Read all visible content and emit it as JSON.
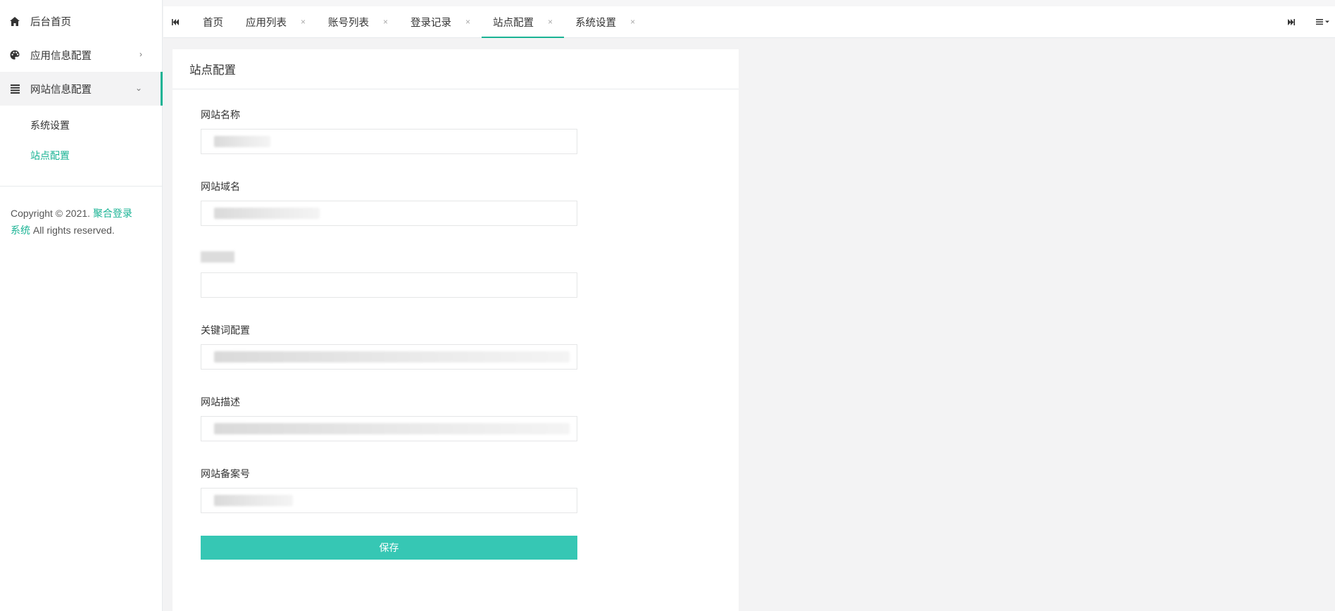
{
  "sidebar": {
    "items": [
      {
        "label": "后台首页",
        "icon": "home-icon"
      },
      {
        "label": "应用信息配置",
        "icon": "palette-icon"
      },
      {
        "label": "网站信息配置",
        "icon": "list-icon"
      }
    ],
    "sub_items": [
      {
        "label": "系统设置"
      },
      {
        "label": "站点配置"
      }
    ],
    "copyright_prefix": "Copyright © 2021.",
    "brand": "聚合登录系统",
    "copyright_suffix": "All rights reserved."
  },
  "tabs": {
    "items": [
      {
        "label": "首页"
      },
      {
        "label": "应用列表"
      },
      {
        "label": "账号列表"
      },
      {
        "label": "登录记录"
      },
      {
        "label": "站点配置"
      },
      {
        "label": "系统设置"
      }
    ],
    "close_glyph": "×",
    "active_index": 4
  },
  "panel": {
    "title": "站点配置",
    "fields": [
      {
        "label": "网站名称"
      },
      {
        "label": "网站域名"
      },
      {
        "label": ""
      },
      {
        "label": "关键词配置"
      },
      {
        "label": "网站描述"
      },
      {
        "label": "网站备案号"
      }
    ],
    "save_label": "保存"
  },
  "colors": {
    "accent": "#1ab394",
    "button": "#36c7b4"
  }
}
